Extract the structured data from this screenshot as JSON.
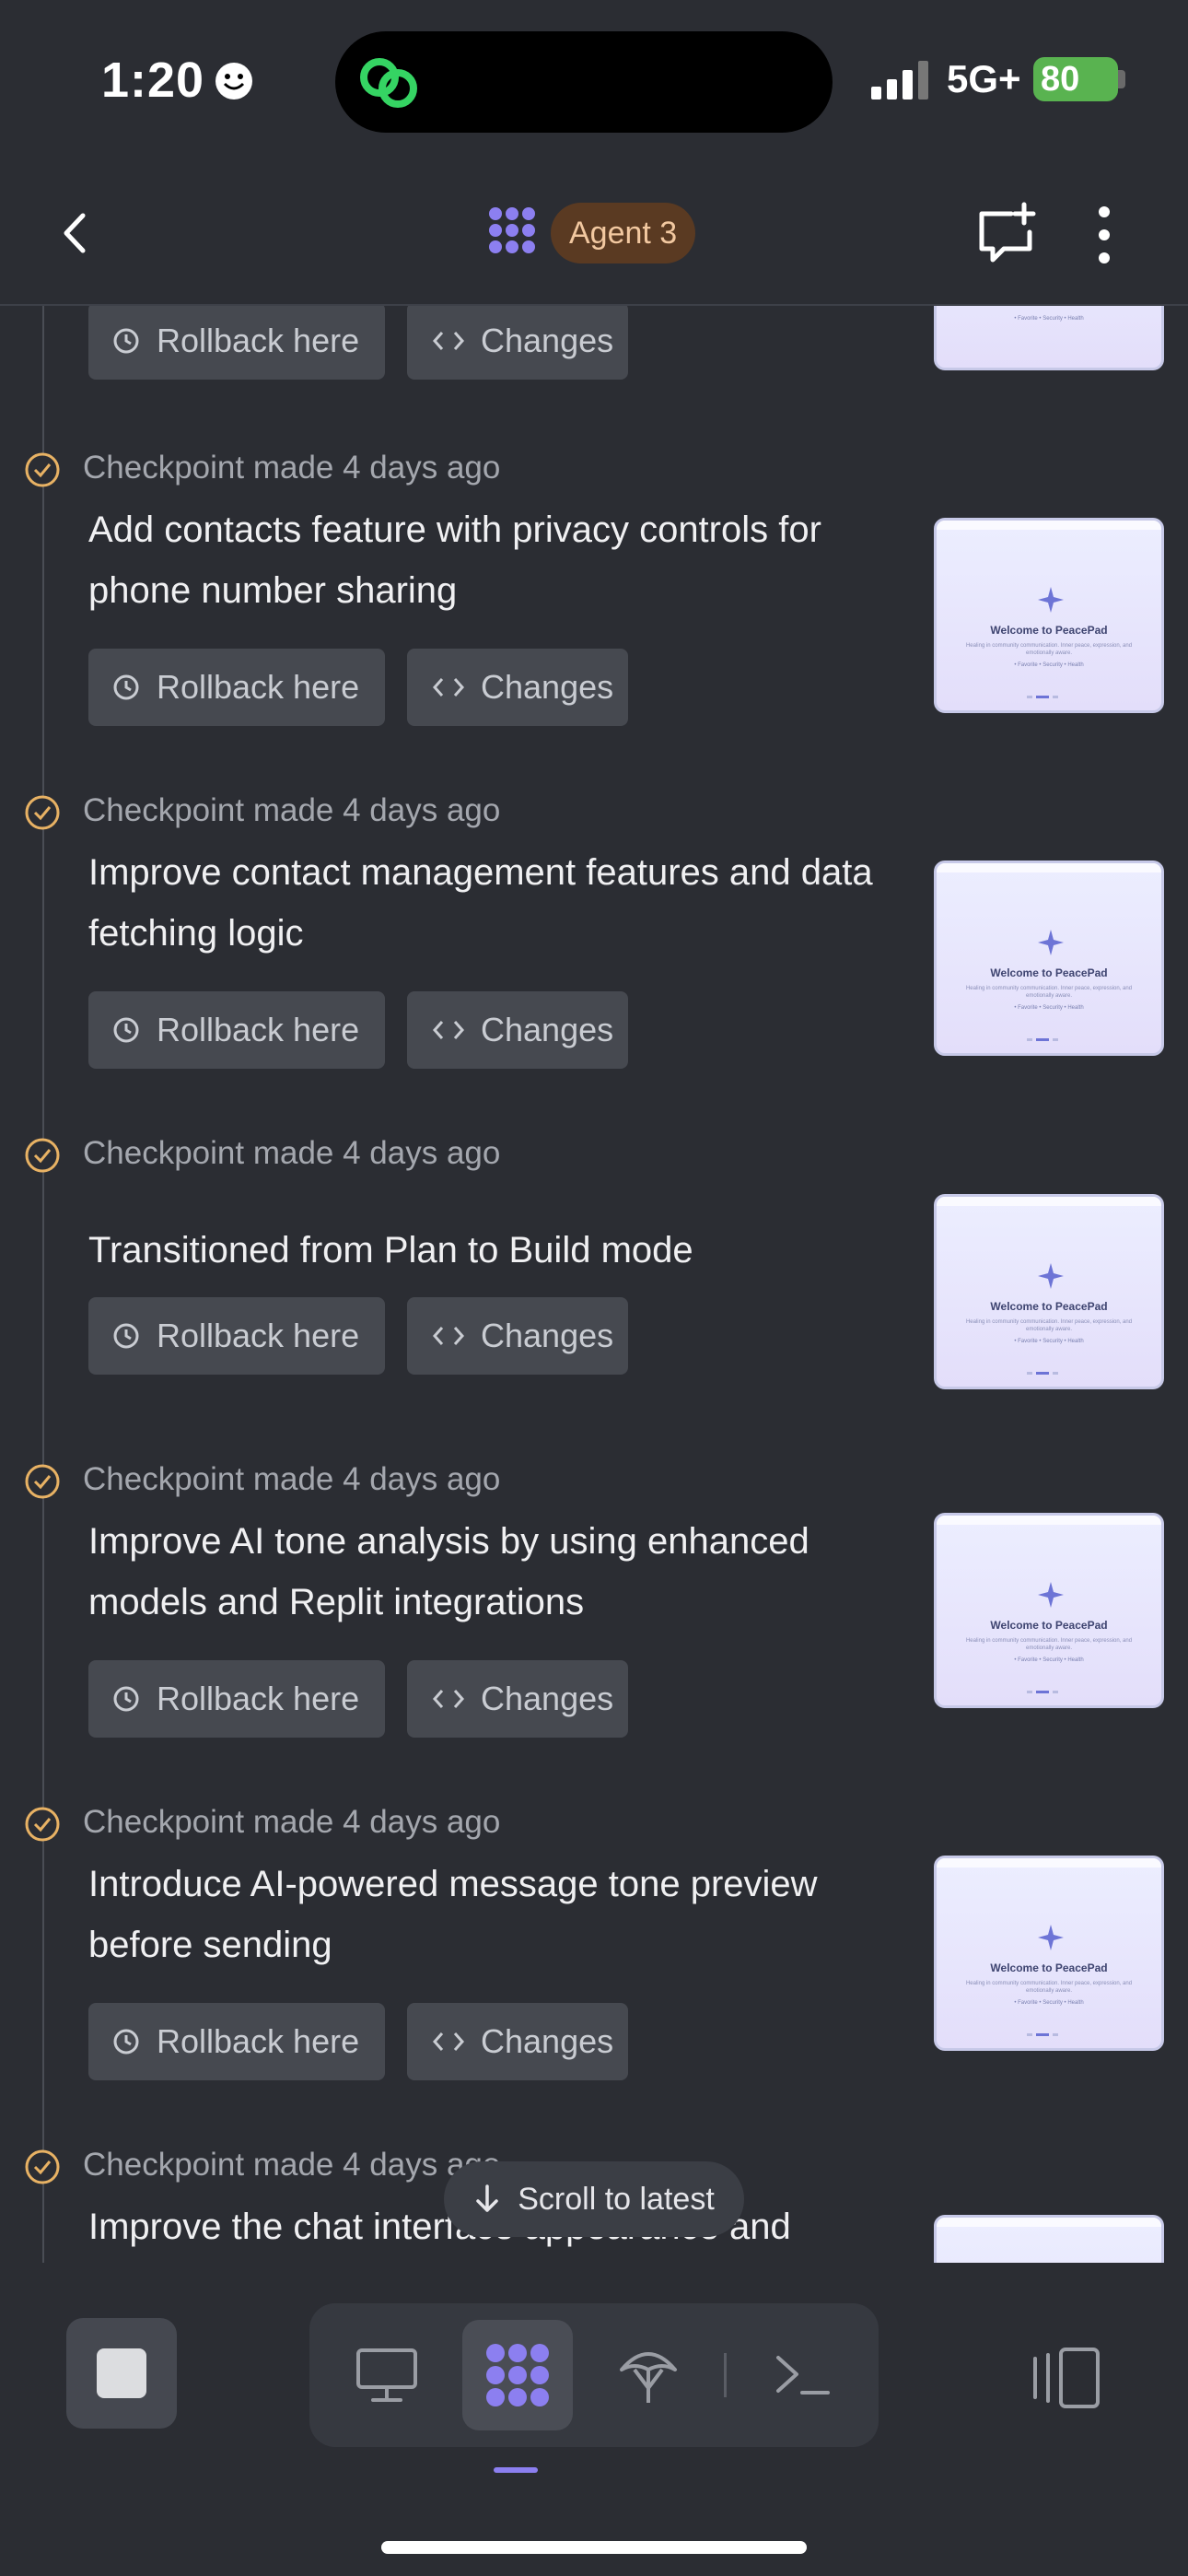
{
  "status_bar": {
    "time": "1:20",
    "network": "5G+",
    "battery": "80"
  },
  "header": {
    "agent_label": "Agent 3"
  },
  "buttons": {
    "rollback": "Rollback here",
    "changes": "Changes"
  },
  "preview": {
    "title": "Welcome to PeacePad",
    "subtitle": "Healing in community communication. Inner peace, expression, and emotionally aware.",
    "features": "• Favorite  • Security  • Health"
  },
  "entries": [
    {
      "meta": "",
      "title": ""
    },
    {
      "meta": "Checkpoint made 4 days ago",
      "title": "Add contacts feature with privacy controls for phone number sharing"
    },
    {
      "meta": "Checkpoint made 4 days ago",
      "title": "Improve contact management features and data fetching logic"
    },
    {
      "meta": "Checkpoint made 4 days ago",
      "title": "Transitioned from Plan to Build mode"
    },
    {
      "meta": "Checkpoint made 4 days ago",
      "title": "Improve AI tone analysis by using enhanced models and Replit integrations"
    },
    {
      "meta": "Checkpoint made 4 days ago",
      "title": "Introduce AI-powered message tone preview before sending"
    },
    {
      "meta": "Checkpoint made 4 days ago",
      "title": "Improve the chat interface appearance and"
    }
  ],
  "scroll_latest": "Scroll to latest",
  "colors": {
    "accent": "#8c7ff0",
    "check": "#e8b264",
    "agent_pill_bg": "#5a3a22",
    "agent_pill_text": "#f2c8a0",
    "battery": "#59b350"
  },
  "icons": [
    "smile-icon",
    "link-icon",
    "signal-icon",
    "back-icon",
    "agent-logo-icon",
    "new-chat-icon",
    "more-icon",
    "check-circle-icon",
    "history-icon",
    "code-icon",
    "arrow-down-icon",
    "stop-icon",
    "desktop-icon",
    "agent-icon",
    "deploy-icon",
    "terminal-icon",
    "panel-icon"
  ]
}
